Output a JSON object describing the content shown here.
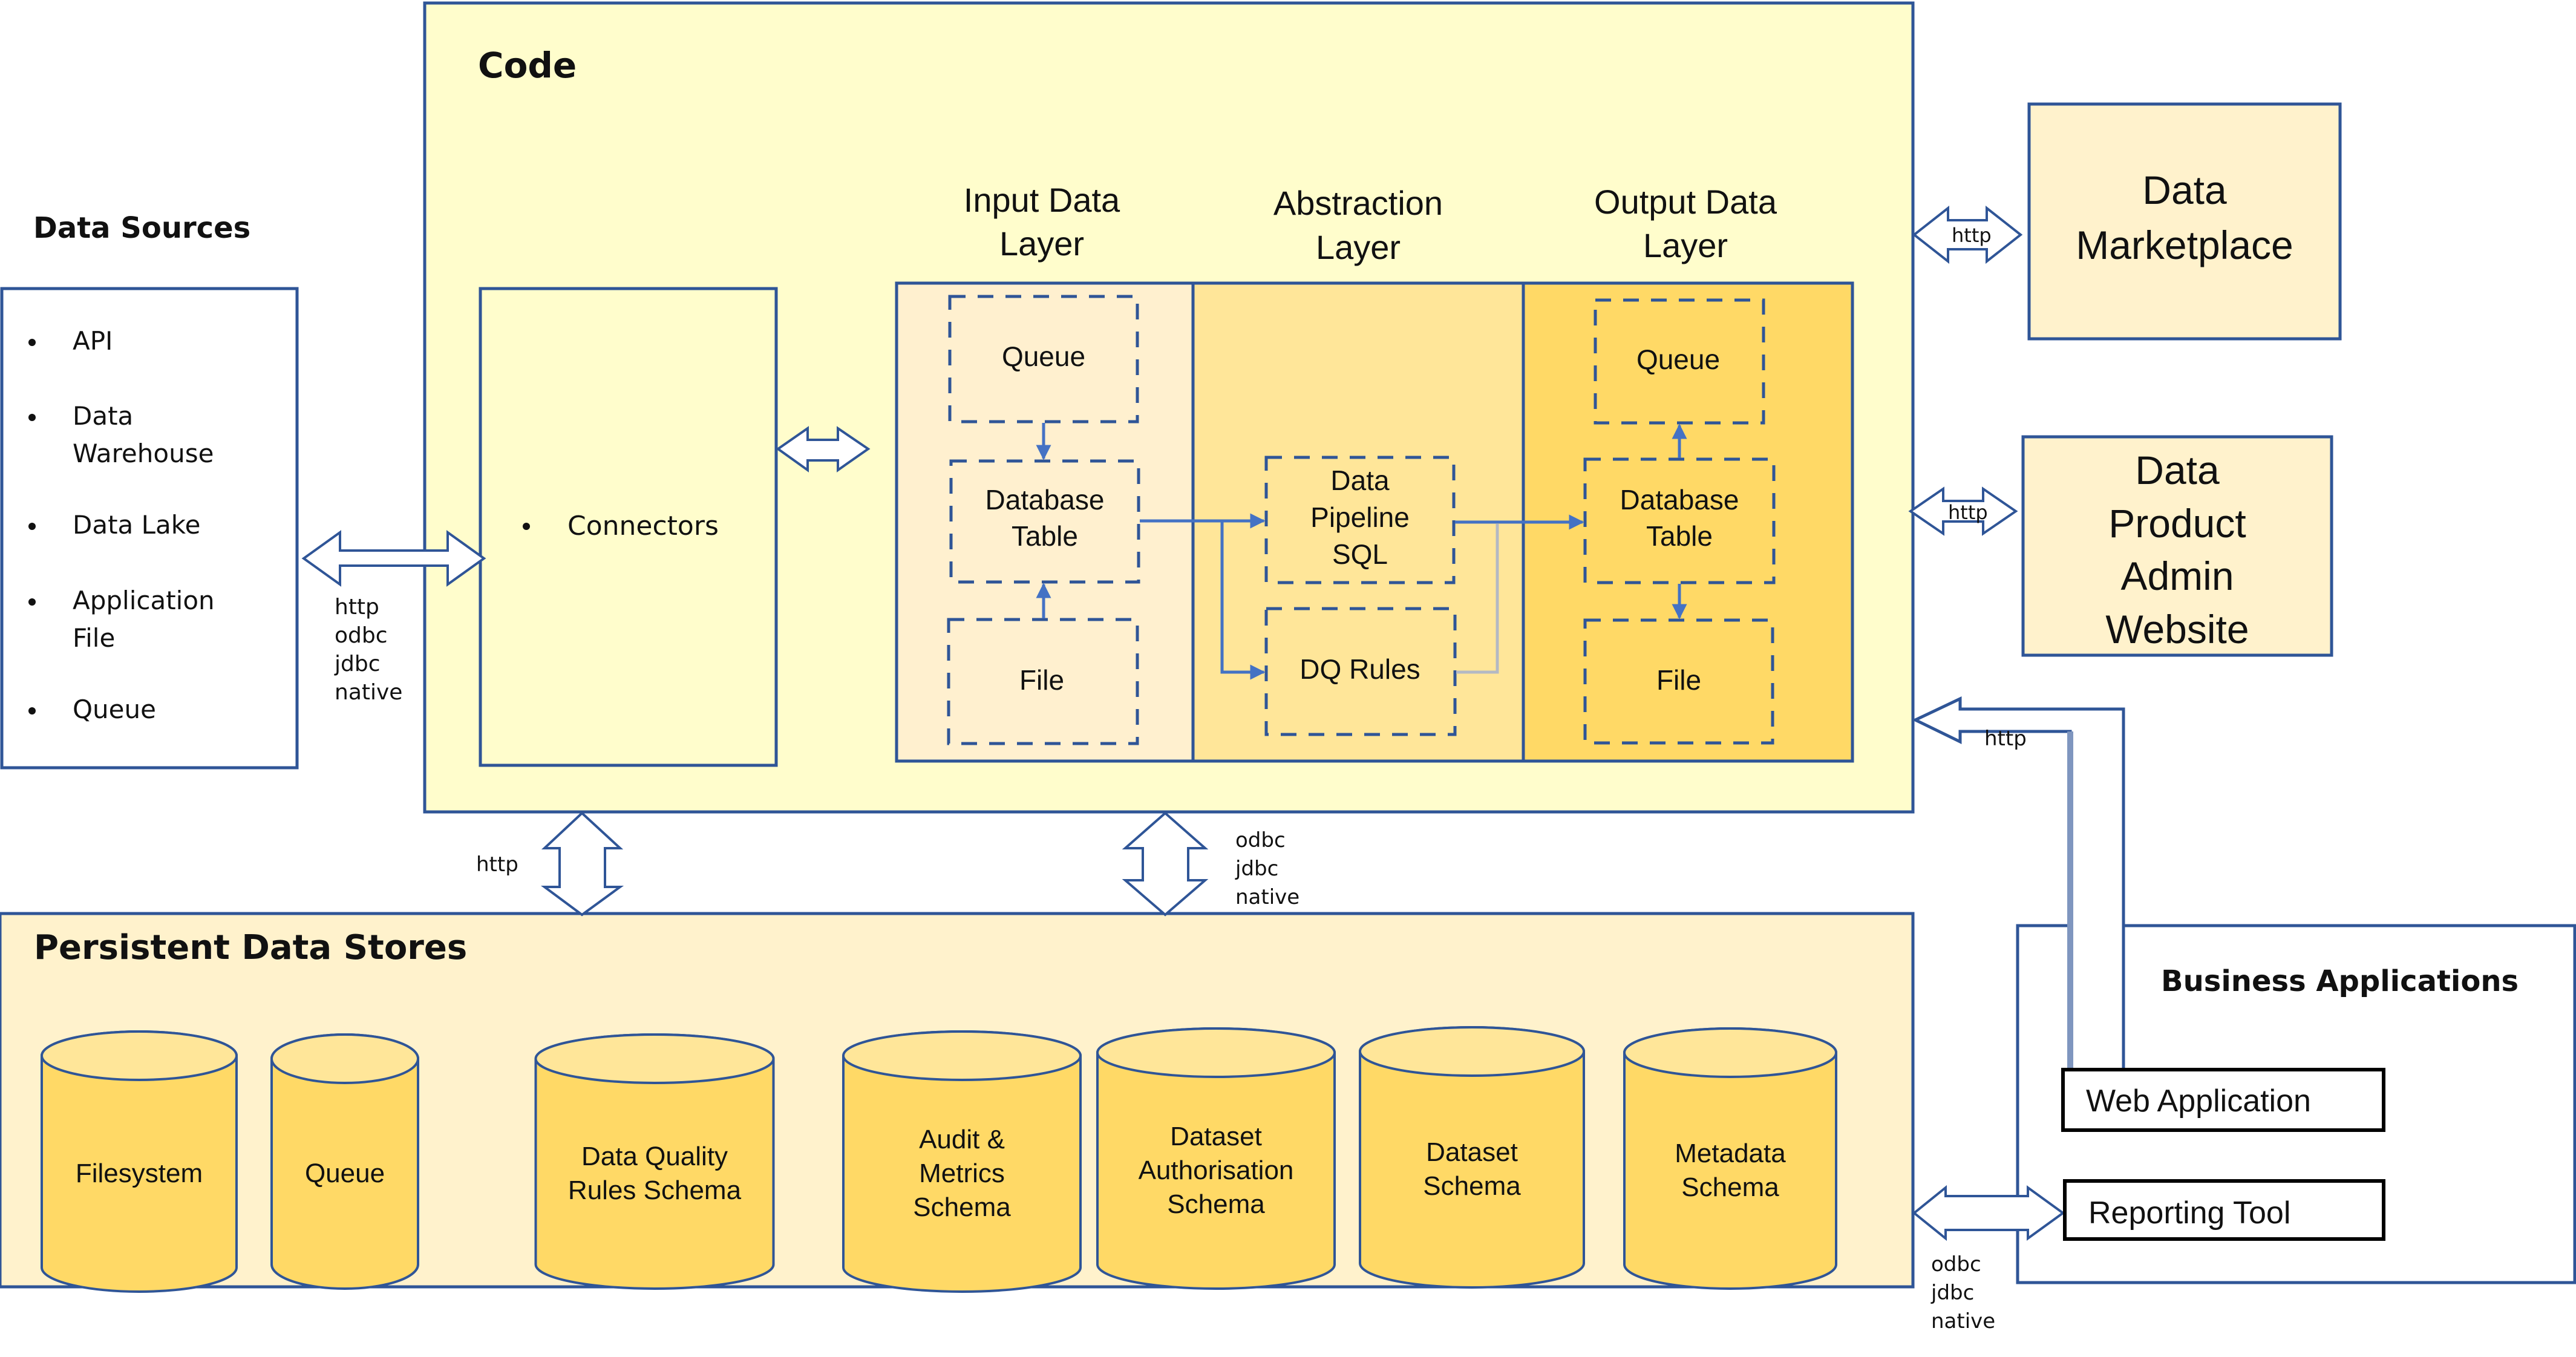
{
  "colors": {
    "code_bg": "#fffdcc",
    "border": "#2f5597",
    "input_layer_bg": "#fff0cf",
    "abstraction_layer_bg": "#ffe699",
    "output_layer_bg": "#ffd966",
    "store_panel_bg": "#fff2cc",
    "cylinder_fill": "#ffd966",
    "cylinder_top": "#ffe699",
    "external_box_bg": "#fff2cc",
    "flow_arrow": "#4472c4"
  },
  "data_sources": {
    "title": "Data Sources",
    "items": [
      {
        "lines": [
          "API"
        ]
      },
      {
        "lines": [
          "Data",
          "Warehouse"
        ]
      },
      {
        "lines": [
          "Data Lake"
        ]
      },
      {
        "lines": [
          "Application",
          "File"
        ]
      },
      {
        "lines": [
          "Queue"
        ]
      }
    ],
    "protocols": [
      "http",
      "odbc",
      "jdbc",
      "native"
    ]
  },
  "code": {
    "title": "Code",
    "connectors_label": "Connectors",
    "layers": [
      {
        "title": [
          "Input Data",
          "Layer"
        ],
        "nodes": [
          {
            "lines": [
              "Queue"
            ]
          },
          {
            "lines": [
              "Database",
              "Table"
            ]
          },
          {
            "lines": [
              "File"
            ]
          }
        ]
      },
      {
        "title": [
          "Abstraction",
          "Layer"
        ],
        "nodes": [
          {
            "lines": [
              "Data",
              "Pipeline",
              "SQL"
            ]
          },
          {
            "lines": [
              "DQ Rules"
            ]
          }
        ]
      },
      {
        "title": [
          "Output Data",
          "Layer"
        ],
        "nodes": [
          {
            "lines": [
              "Queue"
            ]
          },
          {
            "lines": [
              "Database",
              "Table"
            ]
          },
          {
            "lines": [
              "File"
            ]
          }
        ]
      }
    ]
  },
  "external": {
    "marketplace": {
      "lines": [
        "Data",
        "Marketplace"
      ],
      "protocol": "http"
    },
    "admin_site": {
      "lines": [
        "Data",
        "Product",
        "Admin",
        "Website"
      ],
      "protocol": "http"
    }
  },
  "business_apps": {
    "title": "Business Applications",
    "web_app": "Web Application",
    "reporting_tool": "Reporting Tool",
    "web_protocol": "http",
    "reporting_protocols": [
      "odbc",
      "jdbc",
      "native"
    ]
  },
  "persistent_stores": {
    "title": "Persistent Data Stores",
    "code_link_left_protocol": "http",
    "code_link_right_protocols": [
      "odbc",
      "jdbc",
      "native"
    ],
    "stores": [
      {
        "lines": [
          "Filesystem"
        ]
      },
      {
        "lines": [
          "Queue"
        ]
      },
      {
        "lines": [
          "Data Quality",
          "Rules Schema"
        ]
      },
      {
        "lines": [
          "Audit &",
          "Metrics",
          "Schema"
        ]
      },
      {
        "lines": [
          "Dataset",
          "Authorisation",
          "Schema"
        ]
      },
      {
        "lines": [
          "Dataset",
          "Schema"
        ]
      },
      {
        "lines": [
          "Metadata",
          "Schema"
        ]
      }
    ]
  }
}
